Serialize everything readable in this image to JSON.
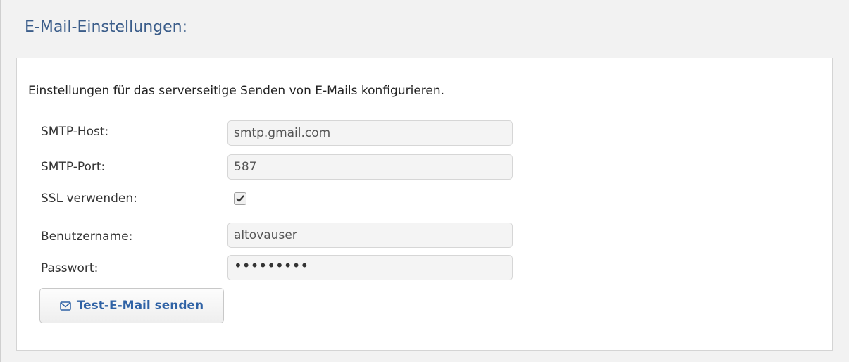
{
  "panel": {
    "title": "E-Mail-Einstellungen:"
  },
  "intro": "Einstellungen für das serverseitige Senden von E-Mails konfigurieren.",
  "fields": {
    "smtp_host": {
      "label": "SMTP-Host:",
      "value": "smtp.gmail.com"
    },
    "smtp_port": {
      "label": "SMTP-Port:",
      "value": "587"
    },
    "ssl": {
      "label": "SSL verwenden:",
      "checked": true
    },
    "username": {
      "label": "Benutzername:",
      "value": "altovauser"
    },
    "password": {
      "label": "Passwort:",
      "value": "•••••••••"
    }
  },
  "button": {
    "label": "Test-E-Mail senden",
    "icon": "envelope-icon"
  },
  "colors": {
    "title": "#3b5d8a",
    "button_text": "#2f62a5"
  }
}
